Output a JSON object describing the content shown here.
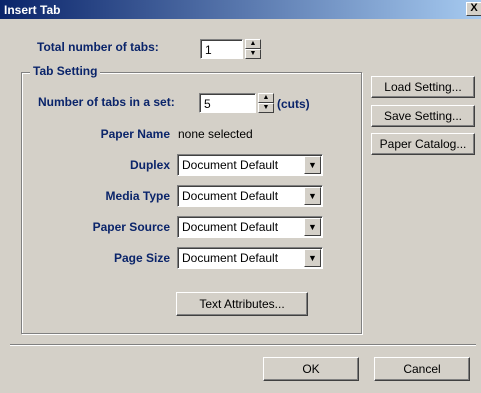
{
  "window": {
    "title": "Insert Tab",
    "close_glyph": "X"
  },
  "total_tabs": {
    "label": "Total number of tabs:",
    "value": "1"
  },
  "tab_setting": {
    "group_label": "Tab Setting",
    "tabs_in_set_label": "Number of tabs in a set:",
    "tabs_in_set_value": "5",
    "cuts_label": "(cuts)",
    "paper_name_label": "Paper Name",
    "paper_name_value": "none selected",
    "duplex_label": "Duplex",
    "duplex_value": "Document Default",
    "media_type_label": "Media Type",
    "media_type_value": "Document Default",
    "paper_source_label": "Paper Source",
    "paper_source_value": "Document Default",
    "page_size_label": "Page Size",
    "page_size_value": "Document Default",
    "text_attributes_label": "Text Attributes..."
  },
  "side_buttons": {
    "load": "Load Setting...",
    "save": "Save Setting...",
    "catalog": "Paper Catalog..."
  },
  "footer": {
    "ok": "OK",
    "cancel": "Cancel"
  },
  "icons": {
    "spin_up": "▲",
    "spin_down": "▼",
    "dropdown": "▼"
  },
  "colors": {
    "title_start": "#0a246a",
    "title_end": "#a6caf0",
    "label_blue": "#0a246a",
    "face": "#d4d0c8"
  }
}
